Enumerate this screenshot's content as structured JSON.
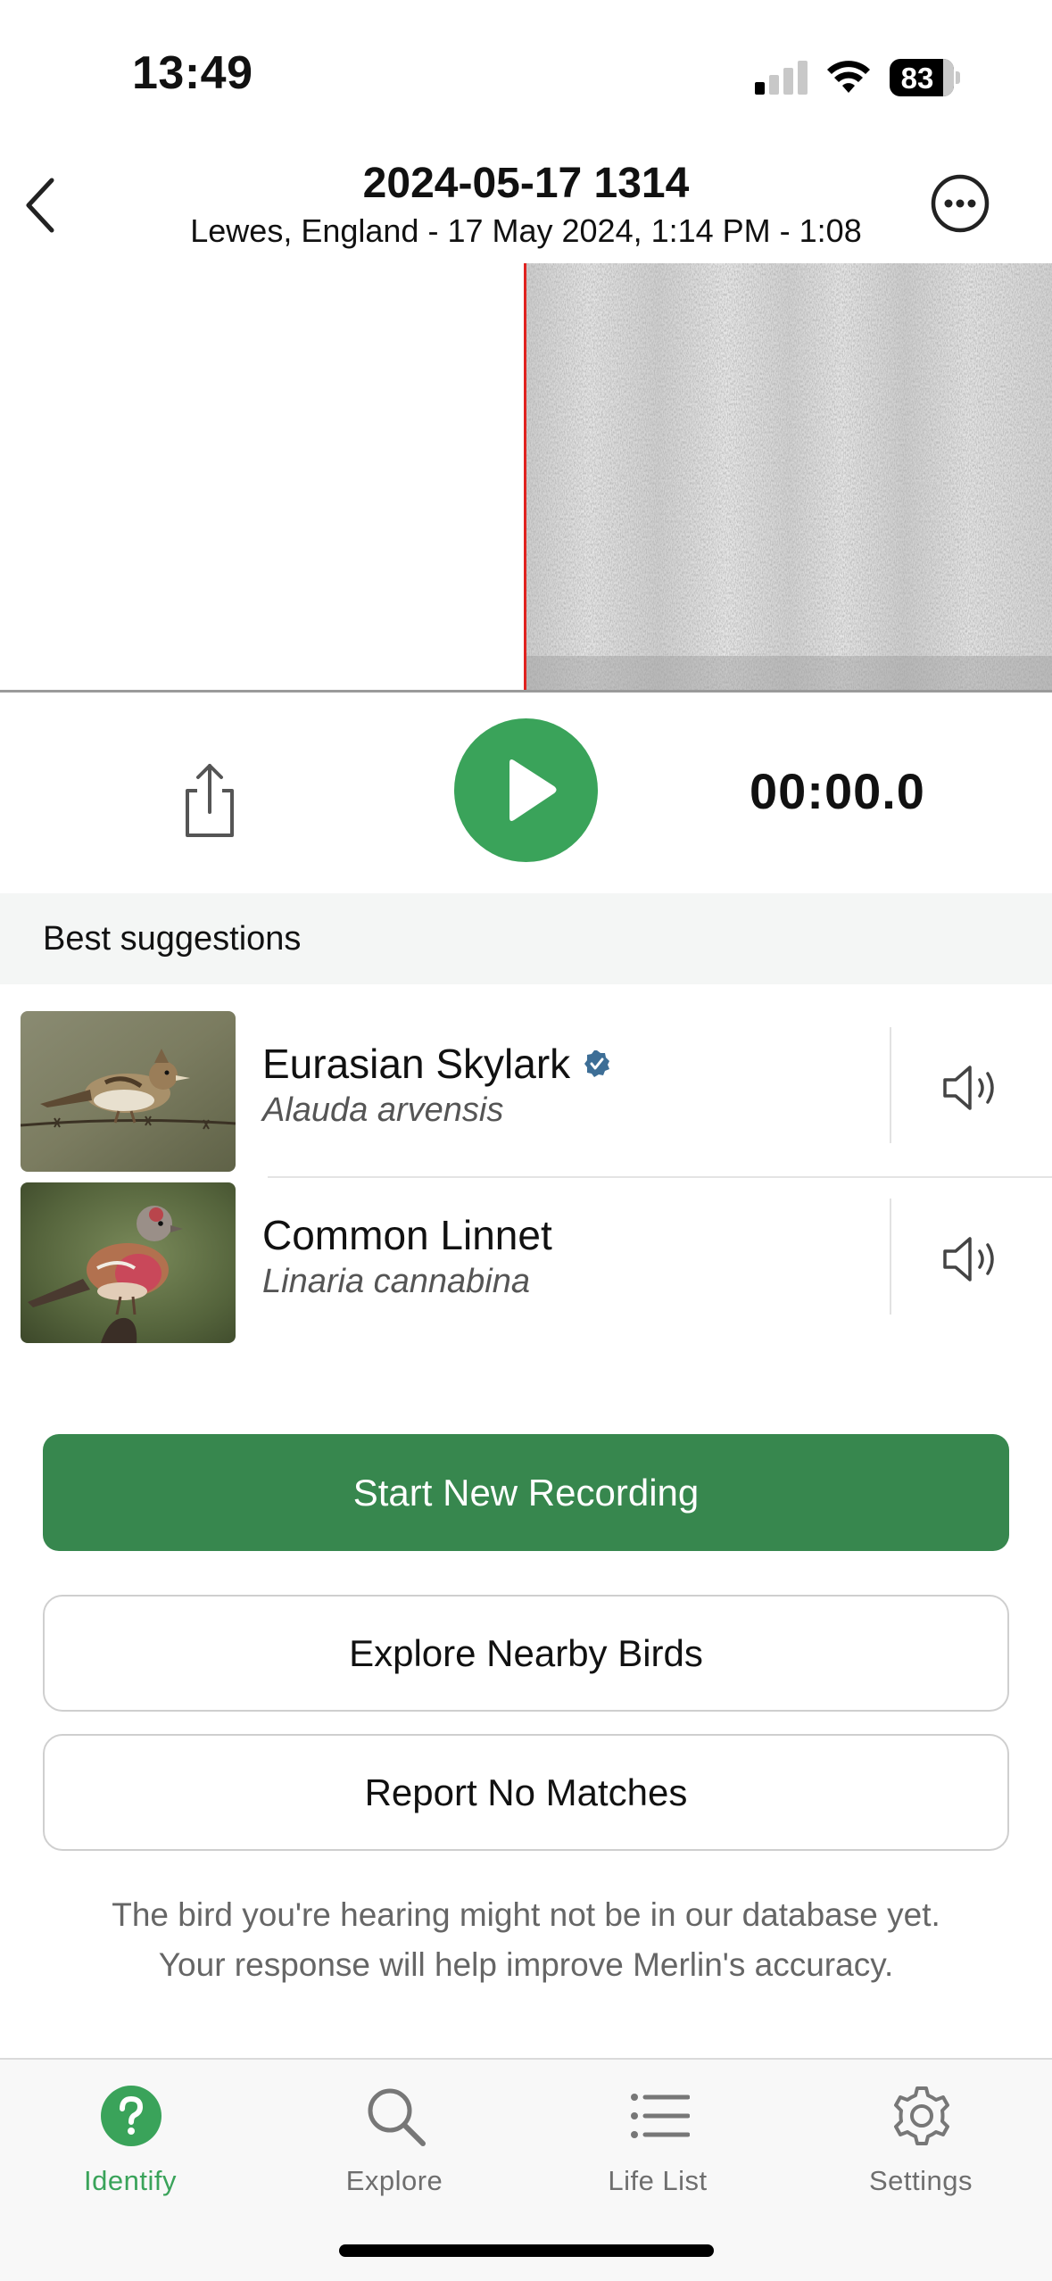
{
  "status_bar": {
    "time": "13:49",
    "battery_level": "83",
    "signal_bars_active": 1,
    "signal_bars_total": 4
  },
  "header": {
    "title": "2024-05-17 1314",
    "subtitle": "Lewes, England - 17 May 2024, 1:14 PM - 1:08",
    "back_icon": "chevron-left-icon",
    "more_icon": "ellipsis-circle-icon"
  },
  "player": {
    "elapsed": "00:00.0",
    "play_icon": "play-icon",
    "share_icon": "share-icon",
    "accent_color": "#3aa35a",
    "playhead_color": "#e0221f"
  },
  "suggestions": {
    "heading": "Best suggestions",
    "items": [
      {
        "common_name": "Eurasian Skylark",
        "scientific_name": "Alauda arvensis",
        "verified": true,
        "sound_icon": "speaker-icon"
      },
      {
        "common_name": "Common Linnet",
        "scientific_name": "Linaria cannabina",
        "verified": false,
        "sound_icon": "speaker-icon"
      }
    ]
  },
  "actions": {
    "start_new_recording": "Start New Recording",
    "explore_nearby": "Explore Nearby Birds",
    "report_no_matches": "Report No Matches",
    "primary_color": "#37874e"
  },
  "info": {
    "line1": "The bird you're hearing might not be in our database yet.",
    "line2": "Your response will help improve Merlin's accuracy."
  },
  "tab_bar": {
    "tabs": [
      {
        "label": "Identify",
        "icon": "question-circle-icon",
        "active": true
      },
      {
        "label": "Explore",
        "icon": "magnifier-icon",
        "active": false
      },
      {
        "label": "Life List",
        "icon": "list-icon",
        "active": false
      },
      {
        "label": "Settings",
        "icon": "gear-icon",
        "active": false
      }
    ]
  }
}
